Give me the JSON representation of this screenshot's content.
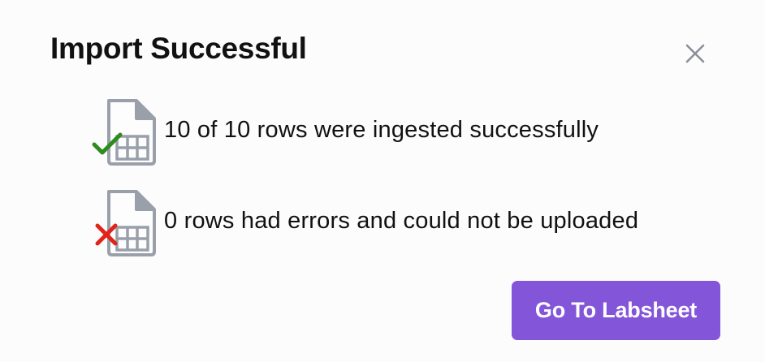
{
  "dialog": {
    "title": "Import Successful",
    "close_icon": "close-icon"
  },
  "results": [
    {
      "icon": "spreadsheet-check-icon",
      "text": "10 of 10 rows were ingested successfully",
      "status_color": "#2e8b1e"
    },
    {
      "icon": "spreadsheet-error-icon",
      "text": "0 rows had errors and could not be uploaded",
      "status_color": "#e0241a"
    }
  ],
  "actions": {
    "primary_label": "Go To Labsheet",
    "primary_color": "#8356d9"
  }
}
